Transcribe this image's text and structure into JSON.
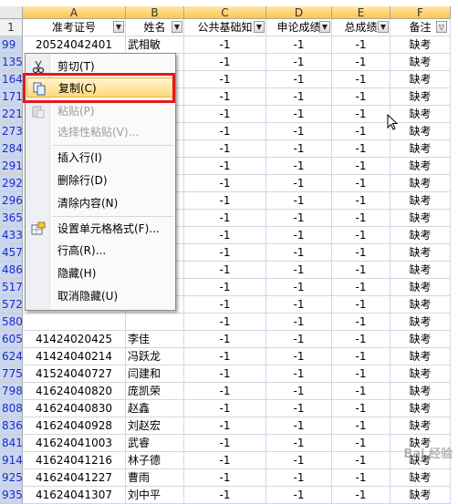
{
  "columns": [
    "A",
    "B",
    "C",
    "D",
    "E",
    "F"
  ],
  "row1_num": "1",
  "headers": [
    "准考证号",
    "姓名",
    "公共基础知",
    "申论成绩",
    "总成绩",
    "备注"
  ],
  "rows": [
    {
      "num": "99",
      "id": "20524042401",
      "name": "武相敏",
      "c": "-1",
      "d": "-1",
      "e": "-1",
      "f": "缺考"
    },
    {
      "num": "135",
      "id": "",
      "name": "",
      "c": "-1",
      "d": "-1",
      "e": "-1",
      "f": "缺考"
    },
    {
      "num": "164",
      "id": "",
      "name": "",
      "c": "-1",
      "d": "-1",
      "e": "-1",
      "f": "缺考"
    },
    {
      "num": "171",
      "id": "",
      "name": "",
      "c": "-1",
      "d": "-1",
      "e": "-1",
      "f": "缺考"
    },
    {
      "num": "221",
      "id": "",
      "name": "",
      "c": "-1",
      "d": "-1",
      "e": "-1",
      "f": "缺考"
    },
    {
      "num": "273",
      "id": "",
      "name": "",
      "c": "-1",
      "d": "-1",
      "e": "-1",
      "f": "缺考"
    },
    {
      "num": "284",
      "id": "",
      "name": "",
      "c": "-1",
      "d": "-1",
      "e": "-1",
      "f": "缺考"
    },
    {
      "num": "291",
      "id": "",
      "name": "",
      "c": "-1",
      "d": "-1",
      "e": "-1",
      "f": "缺考"
    },
    {
      "num": "292",
      "id": "",
      "name": "",
      "c": "-1",
      "d": "-1",
      "e": "-1",
      "f": "缺考"
    },
    {
      "num": "296",
      "id": "",
      "name": "",
      "c": "-1",
      "d": "-1",
      "e": "-1",
      "f": "缺考"
    },
    {
      "num": "365",
      "id": "",
      "name": "",
      "c": "-1",
      "d": "-1",
      "e": "-1",
      "f": "缺考"
    },
    {
      "num": "433",
      "id": "",
      "name": "",
      "c": "-1",
      "d": "-1",
      "e": "-1",
      "f": "缺考"
    },
    {
      "num": "457",
      "id": "",
      "name": "",
      "c": "-1",
      "d": "-1",
      "e": "-1",
      "f": "缺考"
    },
    {
      "num": "486",
      "id": "",
      "name": "",
      "c": "-1",
      "d": "-1",
      "e": "-1",
      "f": "缺考"
    },
    {
      "num": "517",
      "id": "",
      "name": "",
      "c": "-1",
      "d": "-1",
      "e": "-1",
      "f": "缺考"
    },
    {
      "num": "572",
      "id": "",
      "name": "",
      "c": "-1",
      "d": "-1",
      "e": "-1",
      "f": "缺考"
    },
    {
      "num": "580",
      "id": "",
      "name": "",
      "c": "-1",
      "d": "-1",
      "e": "-1",
      "f": "缺考"
    },
    {
      "num": "605",
      "id": "41424020425",
      "name": "李佳",
      "c": "-1",
      "d": "-1",
      "e": "-1",
      "f": "缺考"
    },
    {
      "num": "624",
      "id": "41424040214",
      "name": "冯跃龙",
      "c": "-1",
      "d": "-1",
      "e": "-1",
      "f": "缺考"
    },
    {
      "num": "775",
      "id": "41524040727",
      "name": "闫建和",
      "c": "-1",
      "d": "-1",
      "e": "-1",
      "f": "缺考"
    },
    {
      "num": "798",
      "id": "41624040820",
      "name": "庞凯荣",
      "c": "-1",
      "d": "-1",
      "e": "-1",
      "f": "缺考"
    },
    {
      "num": "808",
      "id": "41624040830",
      "name": "赵鑫",
      "c": "-1",
      "d": "-1",
      "e": "-1",
      "f": "缺考"
    },
    {
      "num": "836",
      "id": "41624040928",
      "name": "刘赵宏",
      "c": "-1",
      "d": "-1",
      "e": "-1",
      "f": "缺考"
    },
    {
      "num": "841",
      "id": "41624041003",
      "name": "武睿",
      "c": "-1",
      "d": "-1",
      "e": "-1",
      "f": "缺考"
    },
    {
      "num": "914",
      "id": "41624041216",
      "name": "林子德",
      "c": "-1",
      "d": "-1",
      "e": "-1",
      "f": "缺考"
    },
    {
      "num": "925",
      "id": "41624041227",
      "name": "曹雨",
      "c": "-1",
      "d": "-1",
      "e": "-1",
      "f": "缺考"
    },
    {
      "num": "935",
      "id": "41624041307",
      "name": "刘中平",
      "c": "-1",
      "d": "-1",
      "e": "-1",
      "f": "缺考"
    }
  ],
  "menu": {
    "cut": "剪切(T)",
    "copy": "复制(C)",
    "paste": "粘贴(P)",
    "paste_special": "选择性粘贴(V)...",
    "insert_row": "插入行(I)",
    "delete_row": "删除行(D)",
    "clear": "清除内容(N)",
    "format_cells": "设置单元格格式(F)...",
    "row_height": "行高(R)...",
    "hide": "隐藏(H)",
    "unhide": "取消隐藏(U)"
  },
  "watermark": "Bai 经验",
  "colors": {
    "highlight": "#e3191b",
    "row_number": "#1c2bc7",
    "selection": "#c9d6ee"
  }
}
